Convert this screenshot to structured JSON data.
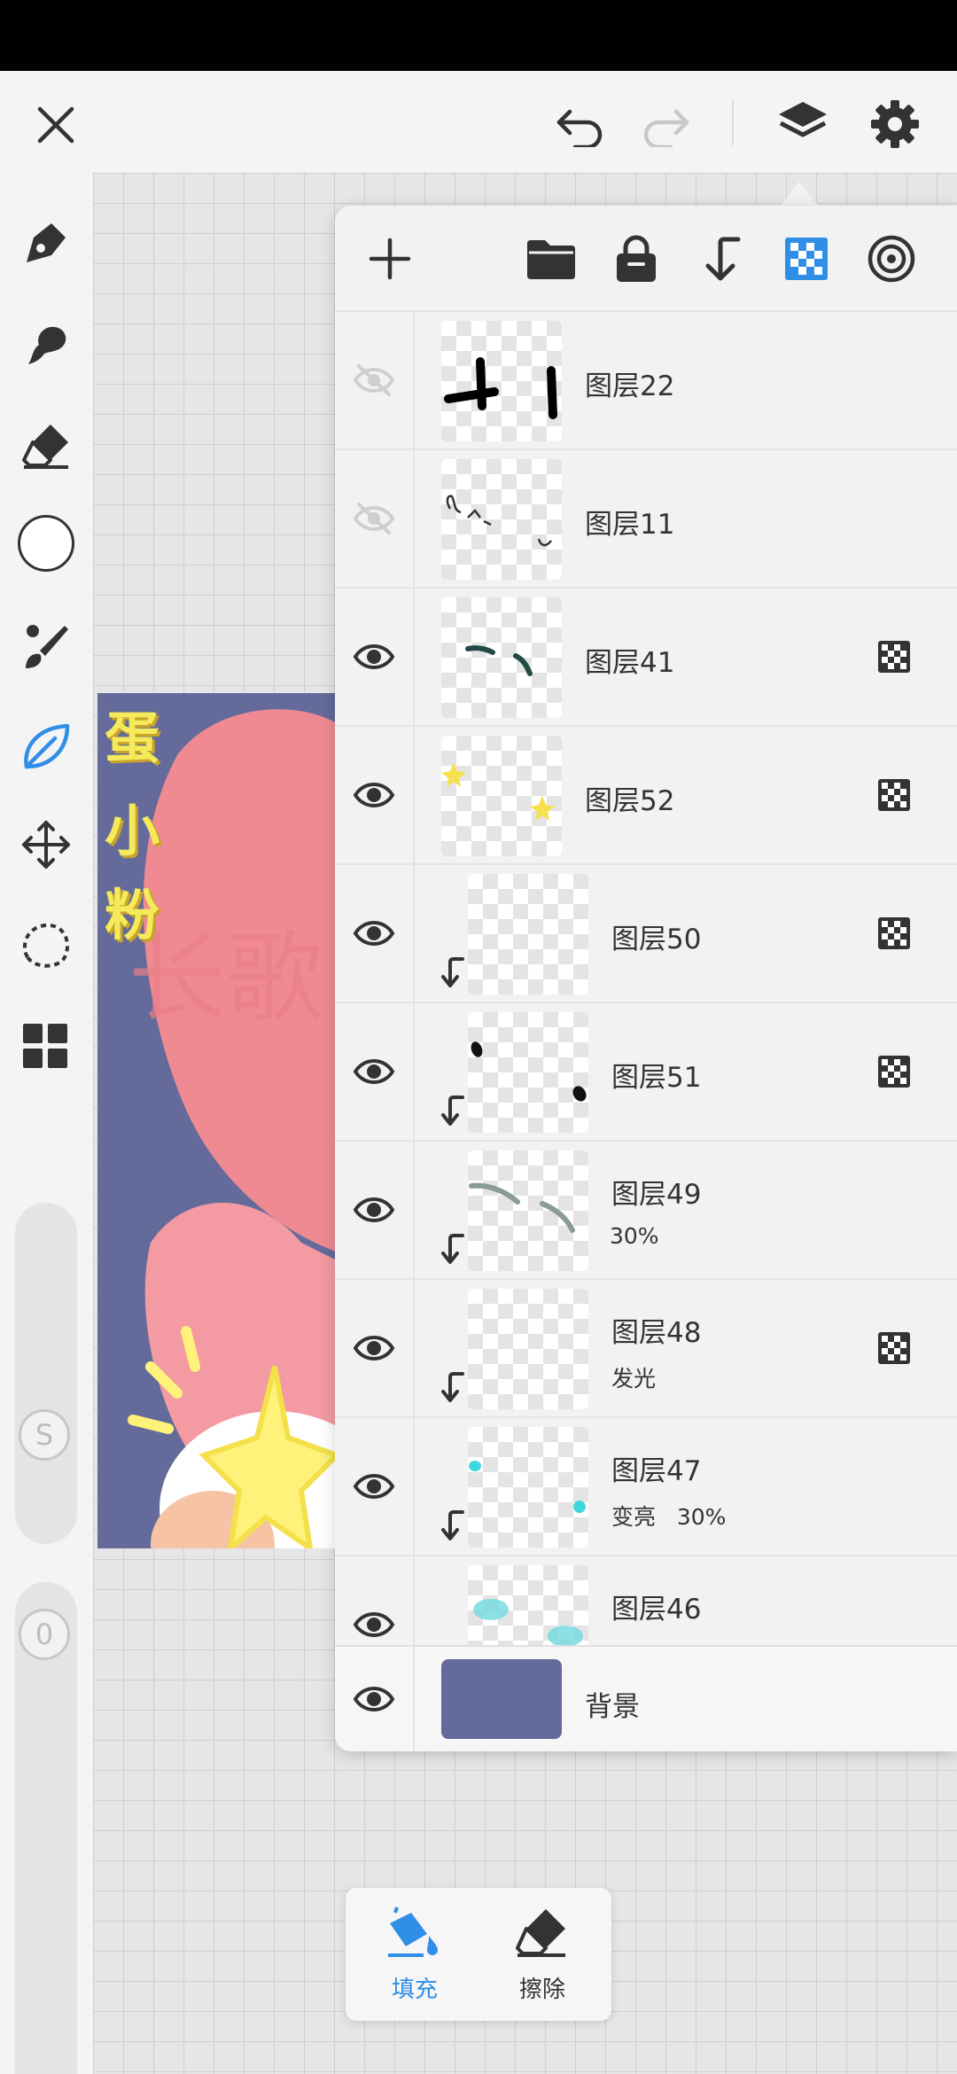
{
  "colors": {
    "accent": "#2f8fe6",
    "background_layer": "#646b9a",
    "panel": "#f2f2f3"
  },
  "toolbar": {
    "icons": [
      "close-icon",
      "undo-icon",
      "redo-icon",
      "layers-icon",
      "settings-icon"
    ]
  },
  "tools": [
    "pen-icon",
    "smudge-icon",
    "eraser-icon",
    "color-swatch",
    "brush-icon",
    "leaf-icon",
    "move-icon",
    "lasso-icon",
    "grid-icon"
  ],
  "sliders": {
    "size_label": "S",
    "opacity_label": "0"
  },
  "artwork": {
    "chars": [
      "蛋",
      "小",
      "粉"
    ]
  },
  "layer_panel": {
    "toolbar_icons": [
      "add-icon",
      "folder-icon",
      "lock-icon",
      "clip-icon",
      "alpha-lock-icon",
      "target-icon"
    ],
    "layers": [
      {
        "name": "图层22",
        "visible": false,
        "clipped": false,
        "alpha_locked": false,
        "sub": ""
      },
      {
        "name": "图层11",
        "visible": false,
        "clipped": false,
        "alpha_locked": false,
        "sub": ""
      },
      {
        "name": "图层41",
        "visible": true,
        "clipped": false,
        "alpha_locked": true,
        "sub": ""
      },
      {
        "name": "图层52",
        "visible": true,
        "clipped": false,
        "alpha_locked": true,
        "sub": ""
      },
      {
        "name": "图层50",
        "visible": true,
        "clipped": true,
        "alpha_locked": true,
        "sub": ""
      },
      {
        "name": "图层51",
        "visible": true,
        "clipped": true,
        "alpha_locked": true,
        "sub": ""
      },
      {
        "name": "图层49",
        "visible": true,
        "clipped": true,
        "alpha_locked": false,
        "sub": "30%"
      },
      {
        "name": "图层48",
        "visible": true,
        "clipped": true,
        "alpha_locked": true,
        "sub": "发光"
      },
      {
        "name": "图层47",
        "visible": true,
        "clipped": true,
        "alpha_locked": false,
        "sub": "变亮   30%"
      },
      {
        "name": "图层46",
        "visible": true,
        "clipped": true,
        "alpha_locked": false,
        "sub": ""
      }
    ],
    "background": {
      "name": "背景",
      "visible": true
    }
  },
  "fill_popup": {
    "fill_label": "填充",
    "erase_label": "擦除"
  }
}
